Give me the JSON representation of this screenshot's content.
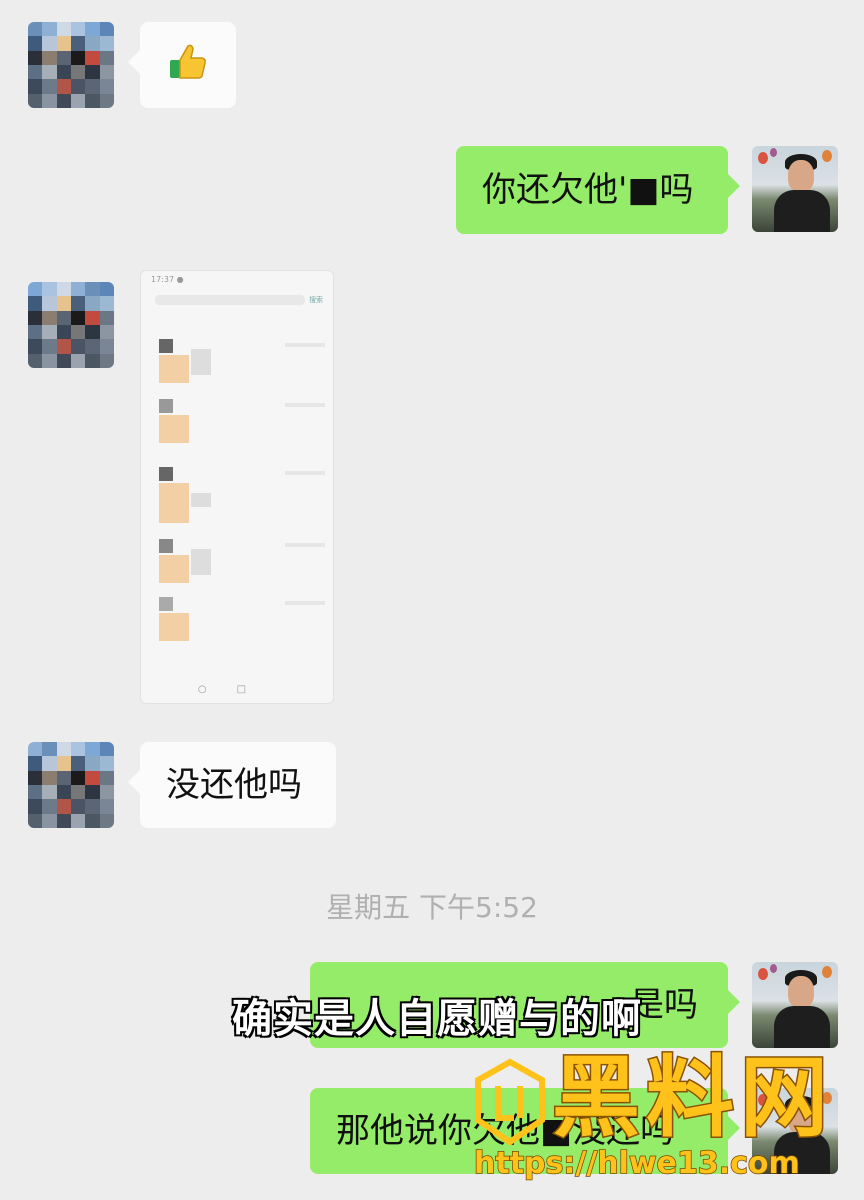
{
  "messages": [
    {
      "side": "in",
      "type": "emoji",
      "icon": "thumbs-up-icon"
    },
    {
      "side": "out",
      "type": "text",
      "text": "你还欠他'■吗"
    },
    {
      "side": "in",
      "type": "image",
      "content": "blurred-phone-screenshot"
    },
    {
      "side": "in",
      "type": "text",
      "text": "没还他吗"
    },
    {
      "side": "out",
      "type": "text",
      "text": "是吗"
    },
    {
      "side": "out",
      "type": "text",
      "text": "那他说你欠他■没还吗"
    }
  ],
  "thumb": {
    "status_time": "17:37 ●",
    "status_right": "4G ■",
    "tag": "搜索"
  },
  "timestamp": "星期五 下午5:52",
  "subtitle": "确实是人自愿赠与的啊",
  "watermark": {
    "brand": "黑料网",
    "url": "https://hlwe13.com"
  },
  "colors": {
    "outgoing_bubble": "#95ec69",
    "incoming_bubble": "#fbfbfb",
    "background": "#ededed"
  }
}
